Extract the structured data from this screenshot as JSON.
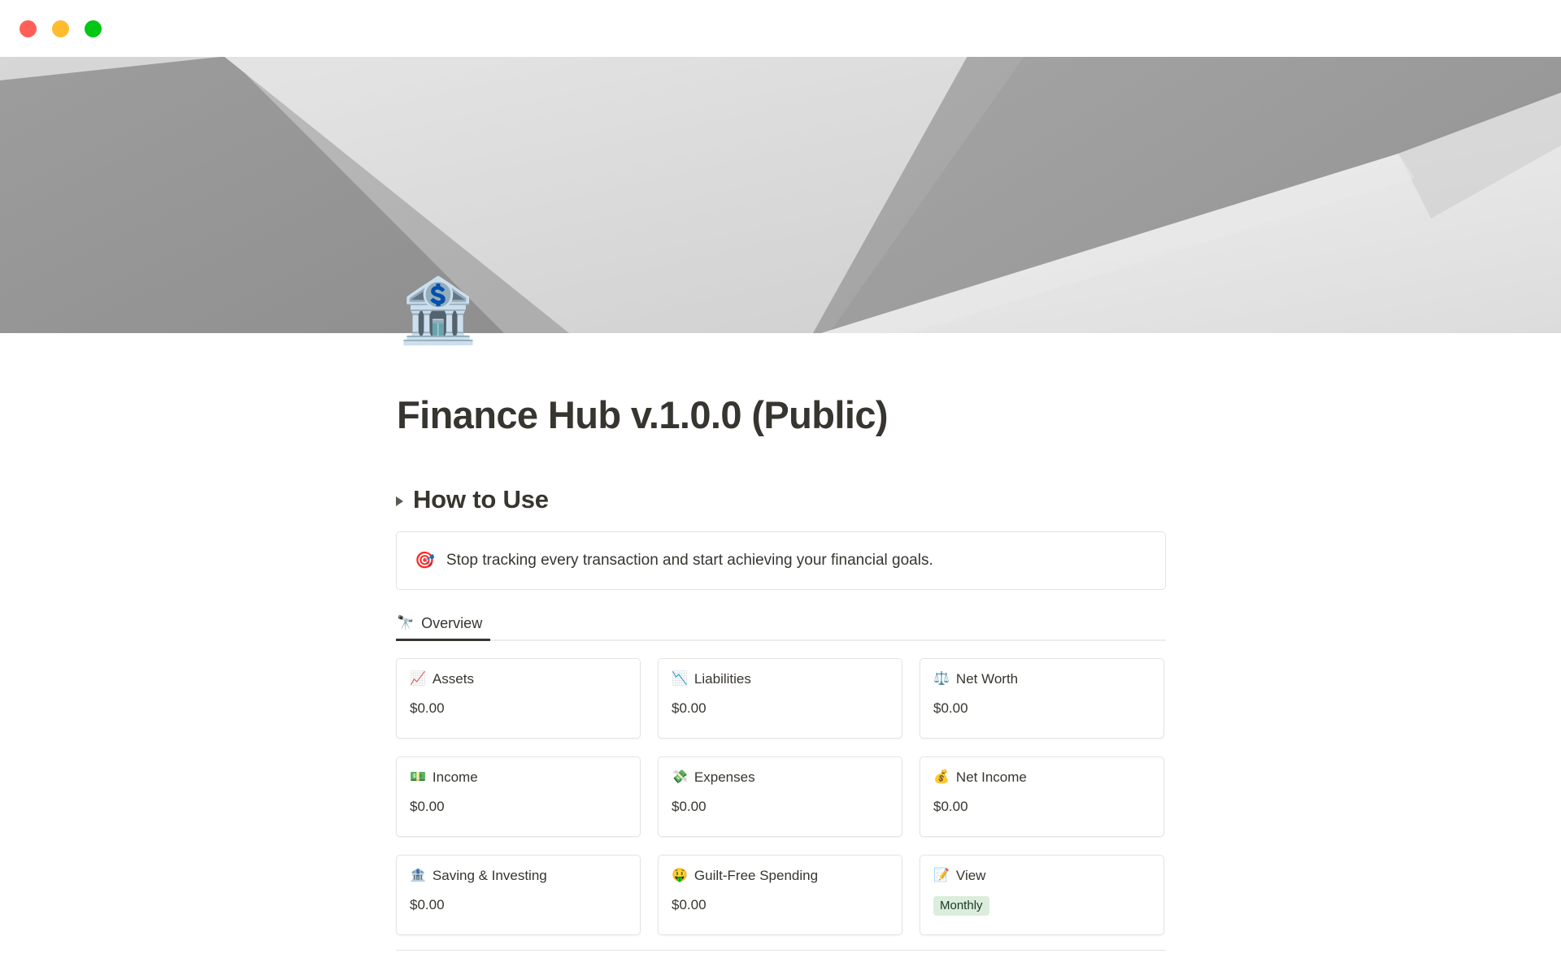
{
  "window": {
    "traffic_lights": [
      {
        "name": "close",
        "color": "#FF5F57"
      },
      {
        "name": "minimize",
        "color": "#FEBC2E"
      },
      {
        "name": "maximize",
        "color": "#00C715"
      }
    ]
  },
  "cover": {
    "description": "abstract grayscale folded paper geometric banner"
  },
  "page": {
    "icon": "🏦",
    "title": "Finance Hub v.1.0.0 (Public)"
  },
  "toggle": {
    "arrow": "collapsed-triangle-right",
    "label": "How to Use"
  },
  "callout": {
    "emoji": "🎯",
    "text": "Stop tracking every transaction and start achieving your financial goals."
  },
  "tabs": [
    {
      "emoji": "🔭",
      "label": "Overview",
      "active": true
    }
  ],
  "cards": [
    {
      "emoji": "📈",
      "title": "Assets",
      "value": "$0.00",
      "type": "value"
    },
    {
      "emoji": "📉",
      "title": "Liabilities",
      "value": "$0.00",
      "type": "value"
    },
    {
      "emoji": "⚖️",
      "title": "Net Worth",
      "value": "$0.00",
      "type": "value"
    },
    {
      "emoji": "💵",
      "title": "Income",
      "value": "$0.00",
      "type": "value"
    },
    {
      "emoji": "💸",
      "title": "Expenses",
      "value": "$0.00",
      "type": "value"
    },
    {
      "emoji": "💰",
      "title": "Net Income",
      "value": "$0.00",
      "type": "value"
    },
    {
      "emoji": "🏦",
      "title": "Saving & Investing",
      "value": "$0.00",
      "type": "value"
    },
    {
      "emoji": "🤑",
      "title": "Guilt-Free Spending",
      "value": "$0.00",
      "type": "value"
    },
    {
      "emoji": "📝",
      "title": "View",
      "value": "Monthly",
      "type": "badge"
    }
  ],
  "colors": {
    "text": "#37352F",
    "card_border": "#E6E4E1",
    "badge_bg": "#DBEDDB",
    "badge_text": "#1C3829",
    "tab_active_underline": "#37352F"
  }
}
